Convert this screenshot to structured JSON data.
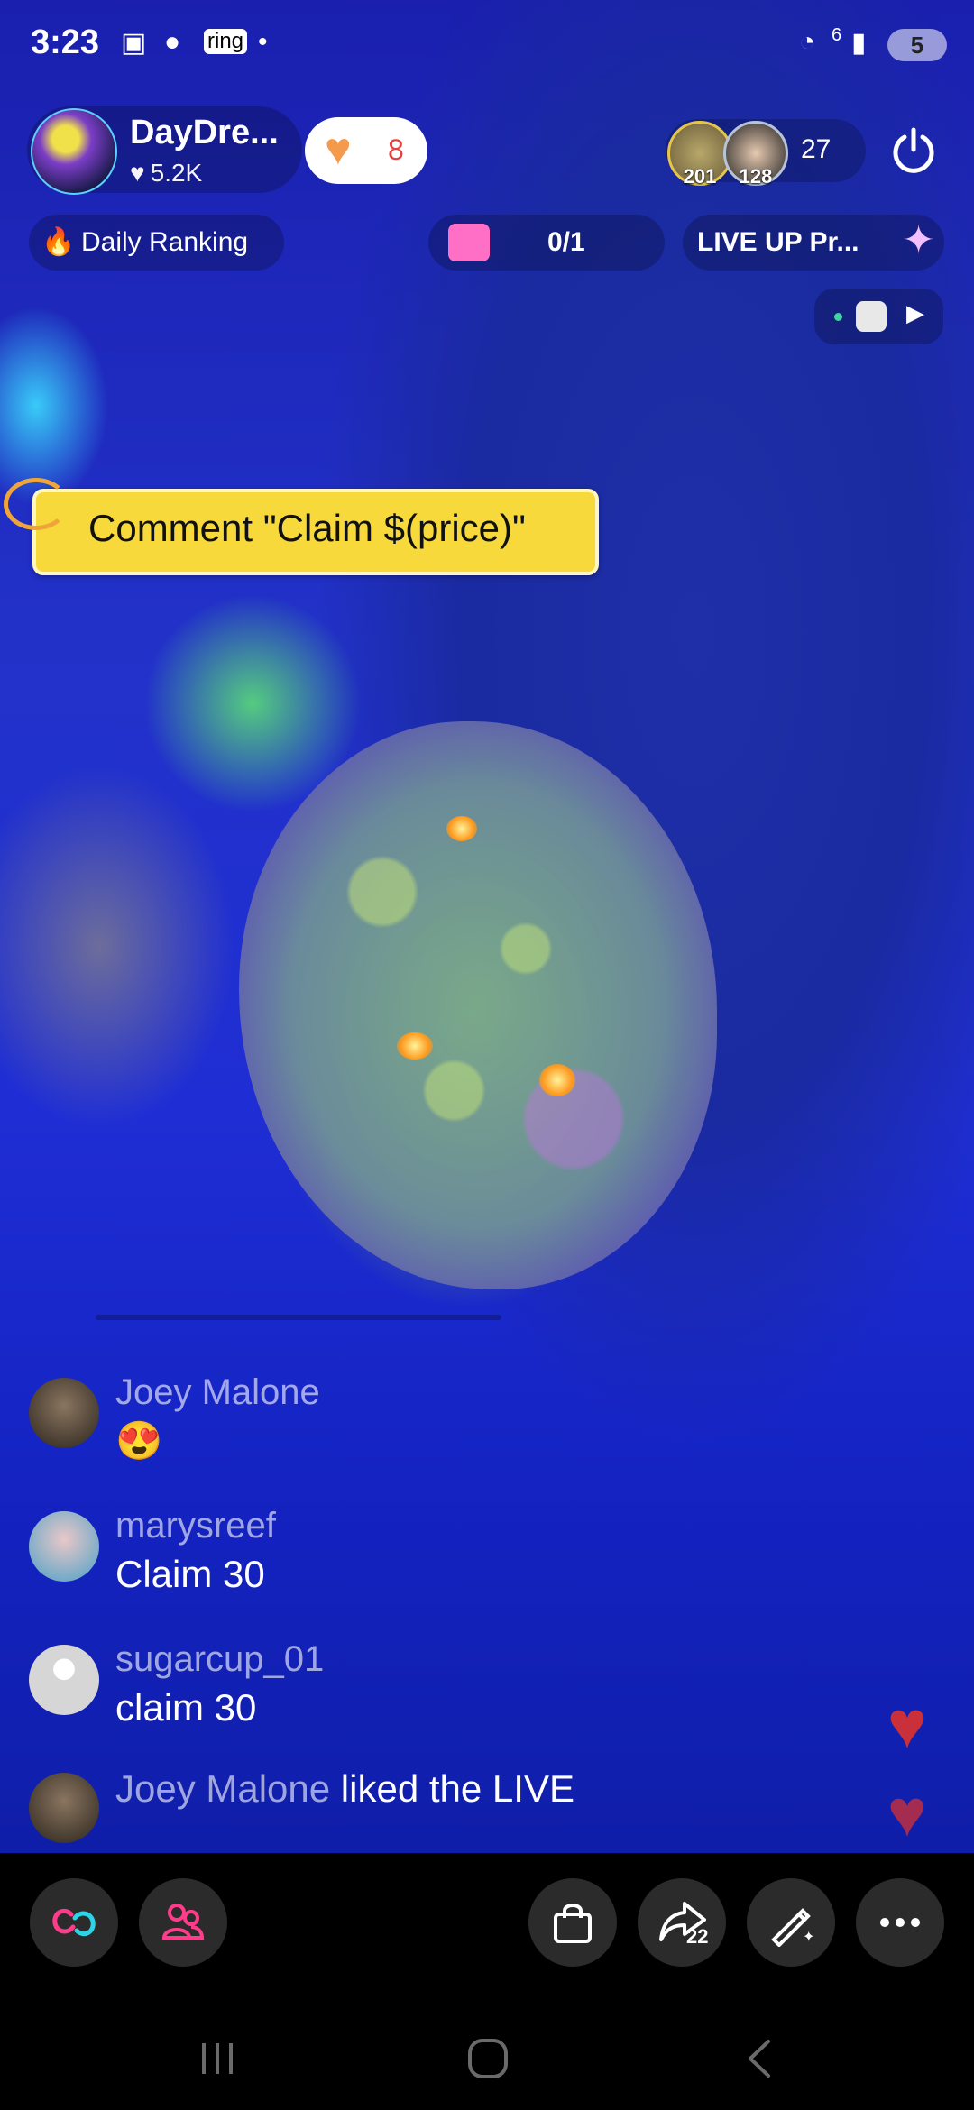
{
  "status_bar": {
    "time": "3:23",
    "network": "6",
    "battery": "5"
  },
  "host": {
    "name": "DayDre...",
    "likes": "5.2K"
  },
  "like_button": {
    "count": "8"
  },
  "viewers": {
    "top1": "201",
    "top2": "128",
    "count": "27"
  },
  "chips": {
    "daily_ranking": "Daily Ranking",
    "progress": "0/1",
    "live_up": "LIVE UP Pr..."
  },
  "banner": {
    "text": "Comment \"Claim $(price)\""
  },
  "comments": [
    {
      "user": "Joey Malone",
      "text": "😍"
    },
    {
      "user": "marysreef",
      "text": "Claim 30"
    },
    {
      "user": "sugarcup_01",
      "text": "claim 30"
    }
  ],
  "activity": {
    "user": "Joey Malone",
    "text": " liked the LIVE"
  },
  "toolbar": {
    "share_count": "22"
  },
  "icons": {
    "power": "power-icon",
    "multi_guest": "link-icon",
    "guests": "people-icon",
    "shop": "shopping-bag-icon",
    "share": "share-icon",
    "effects": "magic-wand-icon",
    "more": "more-icon"
  }
}
